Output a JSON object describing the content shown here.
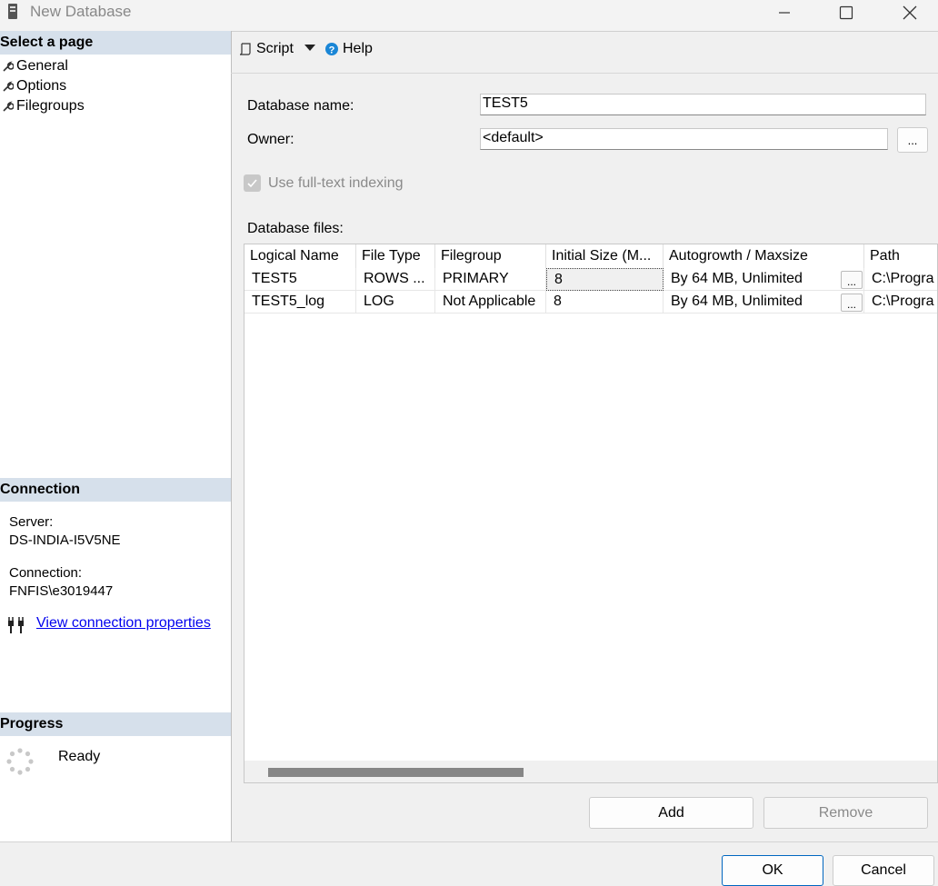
{
  "window": {
    "title": "New Database"
  },
  "left_panel": {
    "select_page_header": "Select a page",
    "pages": [
      {
        "label": "General",
        "icon": "wrench-icon"
      },
      {
        "label": "Options",
        "icon": "wrench-icon"
      },
      {
        "label": "Filegroups",
        "icon": "wrench-icon"
      }
    ],
    "connection_header": "Connection",
    "server_label": "Server:",
    "server_value": "DS-INDIA-I5V5NE",
    "connection_label": "Connection:",
    "connection_value": "FNFIS\\e3019447",
    "view_props_link": "View connection properties",
    "progress_header": "Progress",
    "progress_status": "Ready"
  },
  "toolbar": {
    "script_label": "Script",
    "help_label": "Help"
  },
  "form": {
    "db_name_label": "Database name:",
    "db_name_value": "TEST5",
    "owner_label": "Owner:",
    "owner_value": "<default>",
    "browse_label": "...",
    "fulltext_label": "Use full-text indexing",
    "db_files_label": "Database files:"
  },
  "grid": {
    "columns": [
      "Logical Name",
      "File Type",
      "Filegroup",
      "Initial Size (M...",
      "Autogrowth / Maxsize",
      "Path"
    ],
    "rows": [
      {
        "logical_name": "TEST5",
        "file_type": "ROWS ...",
        "filegroup": "PRIMARY",
        "initial_size": "8",
        "autogrowth": "By 64 MB, Unlimited",
        "path": "C:\\Progra"
      },
      {
        "logical_name": "TEST5_log",
        "file_type": "LOG",
        "filegroup": "Not Applicable",
        "initial_size": "8",
        "autogrowth": "By 64 MB, Unlimited",
        "path": "C:\\Progra"
      }
    ],
    "ellipsis": "..."
  },
  "buttons": {
    "add": "Add",
    "remove": "Remove",
    "ok": "OK",
    "cancel": "Cancel"
  },
  "colors": {
    "section_header": "#d6e0eb",
    "link": "#0000ee",
    "accent": "#0067c0"
  }
}
